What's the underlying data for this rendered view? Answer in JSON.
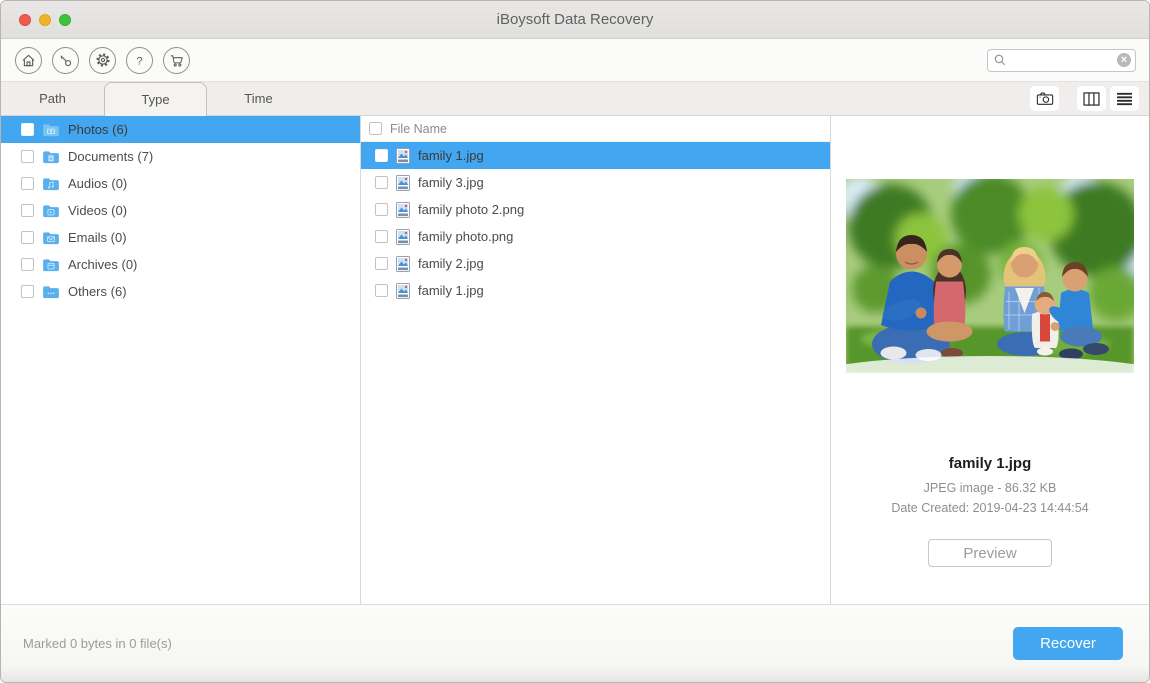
{
  "window": {
    "title": "iBoysoft Data Recovery"
  },
  "toolbar": {
    "icons": [
      "home-icon",
      "key-icon",
      "gear-icon",
      "help-icon",
      "cart-icon"
    ],
    "search": {
      "value": "",
      "icons": [
        "search-icon",
        "clear-icon"
      ]
    }
  },
  "tabs": [
    {
      "label": "Path",
      "active": false
    },
    {
      "label": "Type",
      "active": true
    },
    {
      "label": "Time",
      "active": false
    }
  ],
  "view_controls": {
    "icons": [
      "camera-icon",
      "column-view-icon",
      "list-view-icon"
    ]
  },
  "sidebar": {
    "items": [
      {
        "label": "Photos",
        "count": "(6)",
        "selected": true
      },
      {
        "label": "Documents",
        "count": "(7)",
        "selected": false
      },
      {
        "label": "Audios",
        "count": "(0)",
        "selected": false
      },
      {
        "label": "Videos",
        "count": "(0)",
        "selected": false
      },
      {
        "label": "Emails",
        "count": "(0)",
        "selected": false
      },
      {
        "label": "Archives",
        "count": "(0)",
        "selected": false
      },
      {
        "label": "Others",
        "count": "(6)",
        "selected": false
      }
    ]
  },
  "file_list": {
    "header": "File Name",
    "files": [
      {
        "name": "family 1.jpg",
        "selected": true
      },
      {
        "name": "family 3.jpg",
        "selected": false
      },
      {
        "name": "family photo 2.png",
        "selected": false
      },
      {
        "name": "family photo.png",
        "selected": false
      },
      {
        "name": "family 2.jpg",
        "selected": false
      },
      {
        "name": "family 1.jpg",
        "selected": false
      }
    ]
  },
  "preview": {
    "file_name": "family 1.jpg",
    "type_size": "JPEG image - 86.32 KB",
    "date_created": "Date Created: 2019-04-23 14:44:54",
    "button_label": "Preview",
    "image_description": "family of five sitting on grass in a park"
  },
  "footer": {
    "status": "Marked 0 bytes in 0 file(s)",
    "recover_label": "Recover"
  },
  "colors": {
    "accent": "#42a7f0",
    "selection": "#42a7f0"
  }
}
